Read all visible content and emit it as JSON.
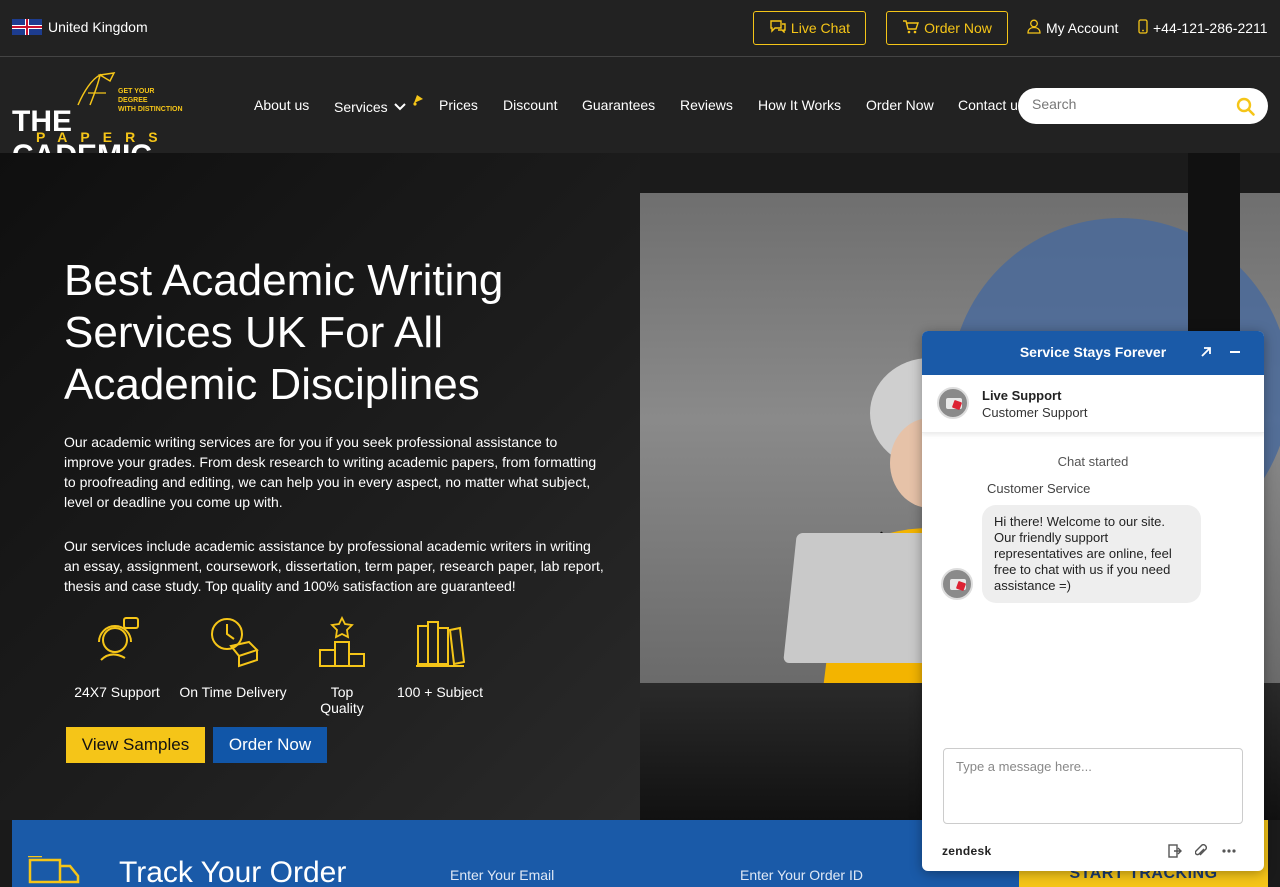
{
  "topbar": {
    "region": "United Kingdom",
    "live_chat": "Live Chat",
    "order_now": "Order Now",
    "my_account": "My Account",
    "phone": "+44-121-286-2211"
  },
  "logo": {
    "main": "THE  CADEMIC",
    "sub": "PAPERS",
    "tagline_1": "GET YOUR DEGREE",
    "tagline_2": "WITH DISTINCTION"
  },
  "nav": {
    "items": [
      "About us",
      "Services",
      "Prices",
      "Discount",
      "Guarantees",
      "Reviews",
      "How It Works",
      "Order Now",
      "Contact us"
    ],
    "search_placeholder": "Search"
  },
  "hero": {
    "title": "Best Academic Writing Services UK For All Academic Disciplines",
    "para1": "Our academic writing services are for you if you seek professional assistance to improve your grades. From desk research to writing academic papers, from formatting to proofreading and editing, we can help you in every aspect, no matter what subject, level or deadline you come up with.",
    "para2": "Our services include academic assistance by professional academic writers in writing an essay, assignment, coursework, dissertation, term paper, research paper, lab report, thesis and case study. Top quality and 100% satisfaction are guaranteed!",
    "features": [
      "24X7 Support",
      "On Time Delivery",
      "Top Quality",
      "100 + Subject"
    ],
    "btn_samples": "View Samples",
    "btn_order": "Order Now"
  },
  "track": {
    "title": "Track Your Order",
    "email_placeholder": "Enter Your Email",
    "order_placeholder": "Enter Your Order ID",
    "button": "START TRACKING"
  },
  "chat": {
    "header": "Service Stays Forever",
    "agent_name": "Live Support",
    "agent_role": "Customer Support",
    "status": "Chat started",
    "sender": "Customer Service",
    "message": "Hi there! Welcome to our site. Our friendly support representatives are online, feel free to chat with us if you need assistance =)",
    "input_placeholder": "Type a message here...",
    "brand": "zendesk"
  },
  "colors": {
    "accent": "#f5c518",
    "primary_blue": "#1a5aa8",
    "dark": "#222222"
  }
}
